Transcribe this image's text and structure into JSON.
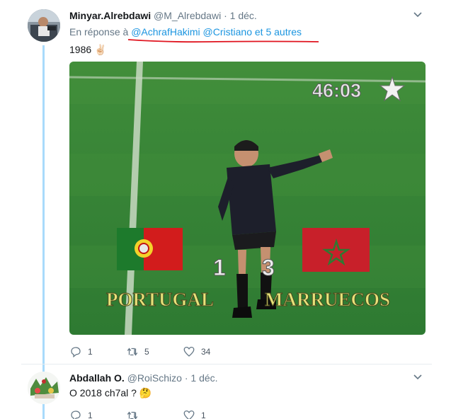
{
  "tweet": {
    "display_name": "Minyar.Alrebdawi",
    "handle": "@M_Alrebdawi",
    "separator": "·",
    "date": "1 déc.",
    "reply_prefix": "En réponse à",
    "reply_mention_1": "@AchrafHakimi",
    "reply_mention_2": "@Cristiano",
    "reply_suffix": "et 5 autres",
    "text": "1986",
    "emoji": "✌🏻",
    "media": {
      "clock": "46:03",
      "score_left": "1",
      "score_right": "3",
      "team_left": "PORTUGAL",
      "team_right": "MARRUECOS"
    },
    "replies": "1",
    "retweets": "5",
    "likes": "34"
  },
  "reply": {
    "display_name": "Abdallah O.",
    "handle": "@RoiSchizo",
    "separator": "·",
    "date": "1 déc.",
    "text": "O 2018 ch7al ?",
    "emoji": "🤔",
    "replies": "1",
    "retweets": "",
    "likes": "1"
  },
  "colors": {
    "accent": "#1b95e0",
    "thread_line": "#a9dbfb",
    "annotation_red": "#e0141f",
    "muted": "#657786"
  }
}
